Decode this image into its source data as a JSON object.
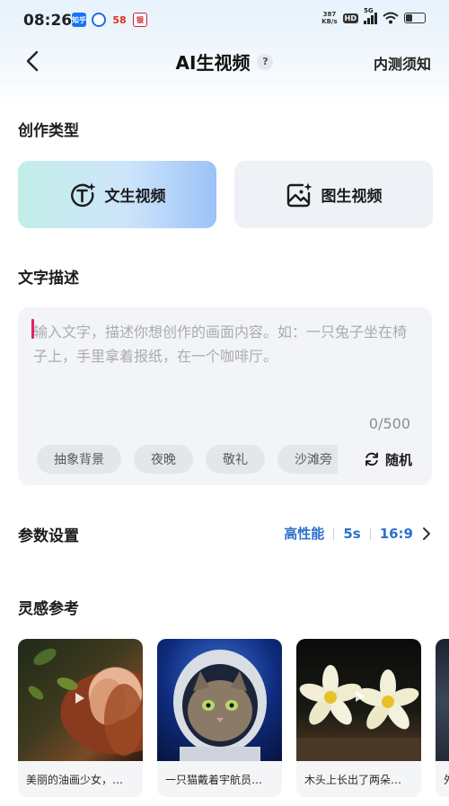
{
  "status_bar": {
    "time": "08:26",
    "apps": [
      "知乎",
      "",
      "58",
      "银"
    ],
    "net_speed_value": "387",
    "net_speed_unit": "KB/s",
    "hd_label": "HD",
    "network": "5G",
    "battery_level": 0.35
  },
  "nav": {
    "title": "AI生视频",
    "help_label": "?",
    "notice_label": "内测须知"
  },
  "creation_type": {
    "section_title": "创作类型",
    "options": [
      {
        "label": "文生视频",
        "icon": "text-to-video-icon",
        "selected": true
      },
      {
        "label": "图生视频",
        "icon": "image-to-video-icon",
        "selected": false
      }
    ]
  },
  "description": {
    "section_title": "文字描述",
    "placeholder": "输入文字，描述你想创作的画面内容。如：一只兔子坐在椅子上，手里拿着报纸，在一个咖啡厅。",
    "char_count": "0/500",
    "chips": [
      "抽象背景",
      "夜晚",
      "敬礼",
      "沙滩旁"
    ],
    "random_label": "随机"
  },
  "params": {
    "section_title": "参数设置",
    "performance": "高性能",
    "duration": "5s",
    "ratio": "16:9"
  },
  "inspiration": {
    "section_title": "灵感参考",
    "cards": [
      {
        "caption": "美丽的油画少女，…"
      },
      {
        "caption": "一只猫戴着宇航员…"
      },
      {
        "caption": "木头上长出了两朵…"
      },
      {
        "caption": "外"
      }
    ]
  },
  "colors": {
    "accent": "#2e70c9",
    "cursor": "#e0245e",
    "selected_gradient_start": "#c2eee8",
    "selected_gradient_end": "#9cc2f7"
  }
}
